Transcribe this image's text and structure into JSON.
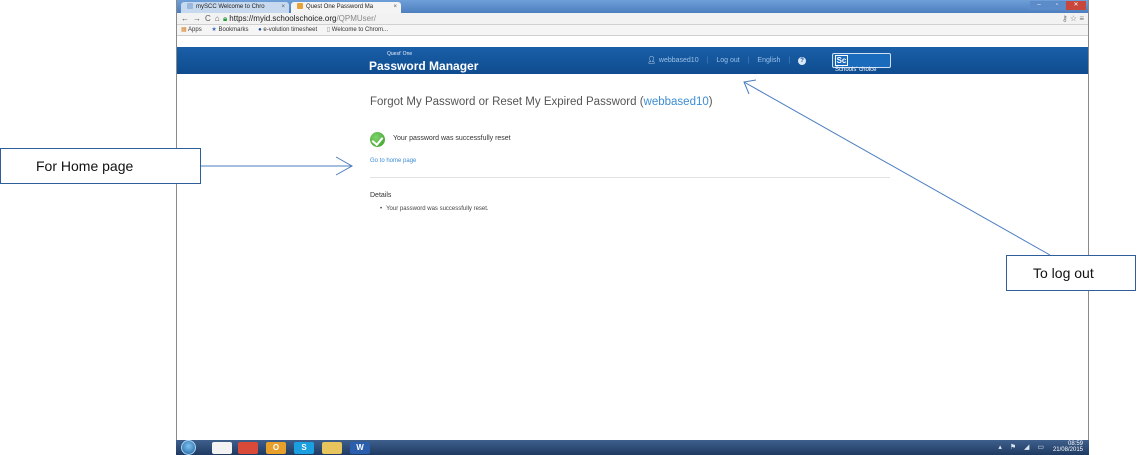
{
  "browser": {
    "tabs": [
      {
        "label": "mySCC Welcome to Chro"
      },
      {
        "label": "Quest One Password Ma"
      }
    ],
    "url_host": "https://myid.schoolschoice.org",
    "url_path": "/QPMUser/",
    "bookmarks": [
      {
        "label": "Apps",
        "icon": "apps-icon"
      },
      {
        "label": "Bookmarks",
        "icon": "star-icon"
      },
      {
        "label": "e-volution timesheet",
        "icon": "globe-icon"
      },
      {
        "label": "Welcome to Chrom...",
        "icon": "page-icon"
      }
    ]
  },
  "header": {
    "brand_super": "Quest' One",
    "brand_name": "Password Manager",
    "username": "webbased10",
    "logout_label": "Log out",
    "language_label": "English",
    "help_symbol": "?",
    "logo_mark": "Sc",
    "logo_text": "Schools' choice"
  },
  "main": {
    "title_text": "Forgot My Password or Reset My Expired Password",
    "title_user_open": " (",
    "title_user": "webbased10",
    "title_user_close": ")",
    "success_message": "Your password was successfully reset",
    "home_link": "Go to home page",
    "details_label": "Details",
    "details_items": [
      "Your password was successfully reset."
    ]
  },
  "taskbar": {
    "items": [
      {
        "label": "",
        "icon": "explorer-icon",
        "color": "#f3f3f3"
      },
      {
        "label": "",
        "icon": "chrome-icon",
        "color": "#d94a38"
      },
      {
        "label": "O",
        "icon": "outlook-icon",
        "color": "#e8a02b"
      },
      {
        "label": "S",
        "icon": "skype-icon",
        "color": "#1aa0e0"
      },
      {
        "label": "",
        "icon": "folder-icon",
        "color": "#e7c45c"
      },
      {
        "label": "W",
        "icon": "word-icon",
        "color": "#2b5fad"
      }
    ],
    "time": "08:59",
    "date": "21/08/2015"
  },
  "annotations": {
    "home_callout": "For Home page",
    "logout_callout": "To log out"
  },
  "colors": {
    "header_blue": "#0f4c8f",
    "link_blue": "#3c8dd5",
    "success_green": "#3a9a2a",
    "annotation_line": "#4a7cc0"
  }
}
